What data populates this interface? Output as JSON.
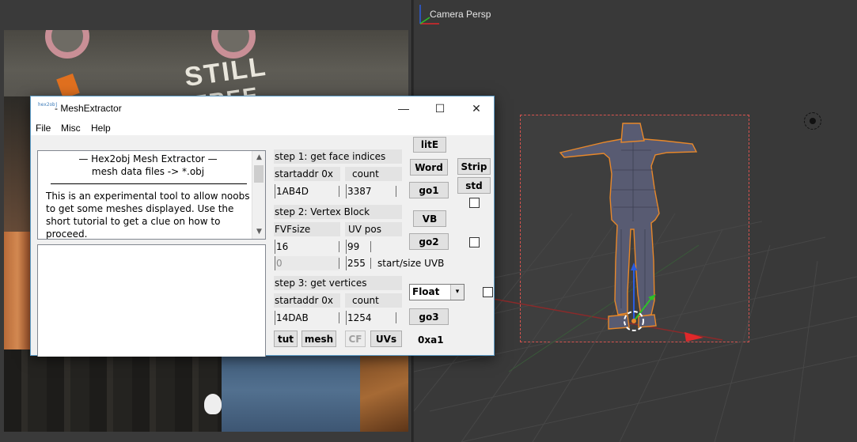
{
  "viewport": {
    "title": "Camera Persp"
  },
  "texture": {
    "shirt_text": "STILL",
    "shirt_text_2": "FREE"
  },
  "window": {
    "icon_text": "hex2obj",
    "title": "- MeshExtractor",
    "minimize_glyph": "—",
    "maximize_glyph": "☐",
    "close_glyph": "✕"
  },
  "menu": {
    "file": "File",
    "misc": "Misc",
    "help": "Help"
  },
  "memo": {
    "line1": "—   Hex2obj Mesh Extractor   —",
    "line2": "mesh data files -> *.obj",
    "body": "This is an experimental tool to allow noobs to get some meshes displayed. Use the short tutorial to get a clue on how to proceed."
  },
  "step1": {
    "title": "step 1: get face indices",
    "startaddr_label": "startaddr 0x",
    "count_label": "count",
    "startaddr": "1AB4D",
    "count": "3387",
    "go_label": "go1"
  },
  "step2": {
    "title": "step 2: Vertex Block",
    "fvfsize_label": "FVFsize",
    "uvpos_label": "UV pos",
    "fvfsize": "16",
    "uvpos": "99",
    "uvb_start": "0",
    "uvb_size": "255",
    "uvb_label": "start/size UVB",
    "go_label": "go2"
  },
  "step3": {
    "title": "step 3: get vertices",
    "startaddr_label": "startaddr 0x",
    "count_label": "count",
    "startaddr": "14DAB",
    "count": "1254",
    "go_label": "go3",
    "format": "Float",
    "offset_readout": "0xa1"
  },
  "buttons": {
    "lite": "litE",
    "word": "Word",
    "strip": "Strip",
    "std": "std",
    "vb": "VB",
    "tut": "tut",
    "mesh": "mesh",
    "cf": "CF",
    "uvs": "UVs"
  },
  "icons": {
    "combo_arrow": "▾",
    "scroll_up": "▲",
    "scroll_down": "▼"
  },
  "colors": {
    "window_border": "#5f9ec9",
    "camera_frame": "#d9534f",
    "selection_outline": "#e8882a",
    "axis_x": "#e0282a",
    "axis_y": "#2ec028",
    "axis_z": "#2a5de0"
  }
}
